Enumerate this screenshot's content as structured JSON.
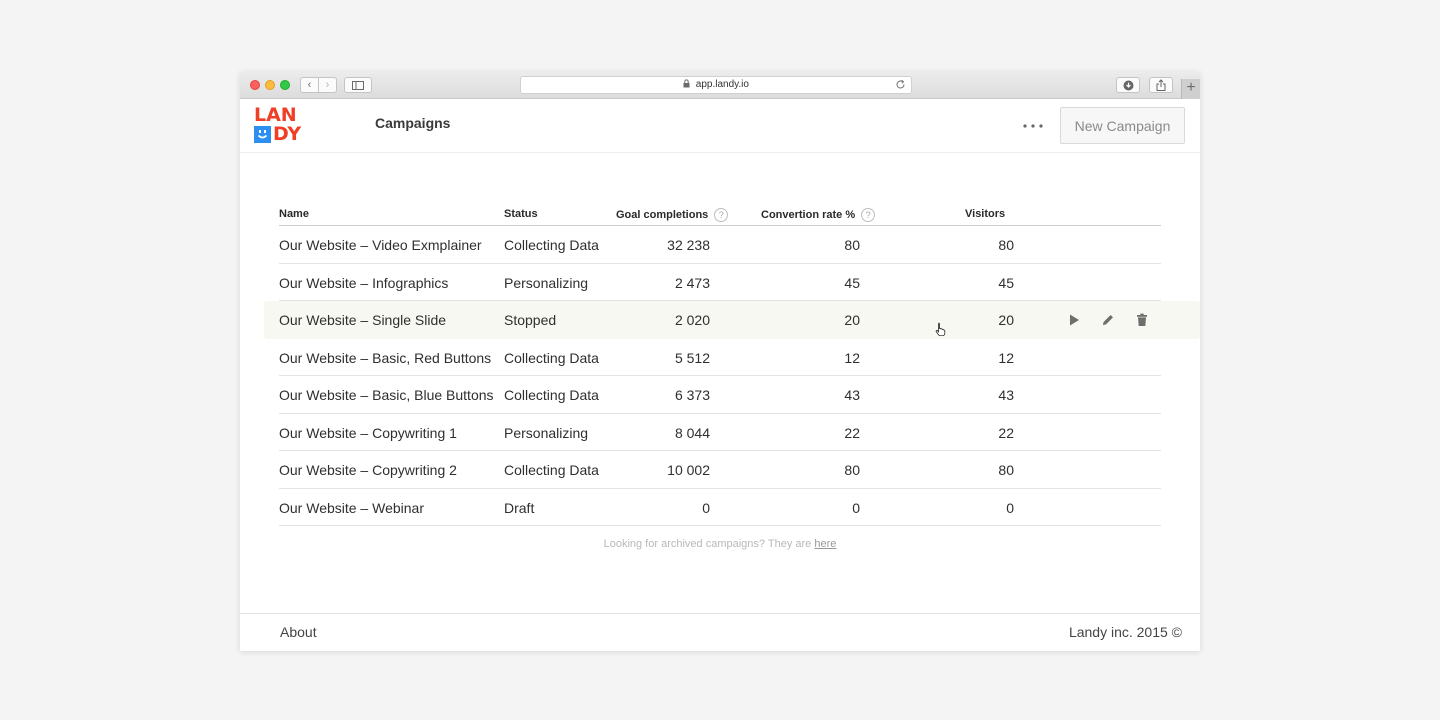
{
  "browser": {
    "url": "app.landy.io",
    "back_label": "‹",
    "forward_label": "›",
    "plus_label": "+"
  },
  "header": {
    "logo_top": "LAN",
    "logo_bottom": "DY",
    "page_title": "Campaigns",
    "new_campaign_label": "New Campaign"
  },
  "colors": {
    "brand_red": "#ef3f25",
    "brand_blue": "#2e8ff2",
    "row_hover": "#f8f8f3"
  },
  "table": {
    "columns": [
      {
        "label": "Name"
      },
      {
        "label": "Status"
      },
      {
        "label": "Goal completions",
        "help_icon": "question-icon"
      },
      {
        "label": "Convertion rate %",
        "help_icon": "question-icon"
      },
      {
        "label": "Visitors"
      }
    ],
    "help_glyph": "?",
    "rows": [
      {
        "name": "Our Website – Video Exmplainer",
        "status": "Collecting Data",
        "goal": "32 238",
        "conv": "80",
        "visitors": "80"
      },
      {
        "name": "Our Website – Infographics",
        "status": "Personalizing",
        "goal": "2 473",
        "conv": "45",
        "visitors": "45"
      },
      {
        "name": "Our Website – Single Slide",
        "status": "Stopped",
        "goal": "2 020",
        "conv": "20",
        "visitors": "20",
        "hovered": true,
        "actions": [
          "play-icon",
          "pencil-icon",
          "trash-icon"
        ]
      },
      {
        "name": "Our Website – Basic, Red Buttons",
        "status": "Collecting Data",
        "goal": "5 512",
        "conv": "12",
        "visitors": "12"
      },
      {
        "name": "Our Website – Basic, Blue Buttons",
        "status": "Collecting Data",
        "goal": "6 373",
        "conv": "43",
        "visitors": "43"
      },
      {
        "name": "Our Website – Copywriting 1",
        "status": "Personalizing",
        "goal": "8 044",
        "conv": "22",
        "visitors": "22"
      },
      {
        "name": "Our Website – Copywriting 2",
        "status": "Collecting Data",
        "goal": "10 002",
        "conv": "80",
        "visitors": "80"
      },
      {
        "name": "Our Website – Webinar",
        "status": "Draft",
        "goal": "0",
        "conv": "0",
        "visitors": "0"
      }
    ]
  },
  "archive": {
    "text": "Looking for archived campaigns? They are ",
    "link": "here"
  },
  "footer": {
    "about": "About",
    "copyright": "Landy inc. 2015 ©"
  }
}
